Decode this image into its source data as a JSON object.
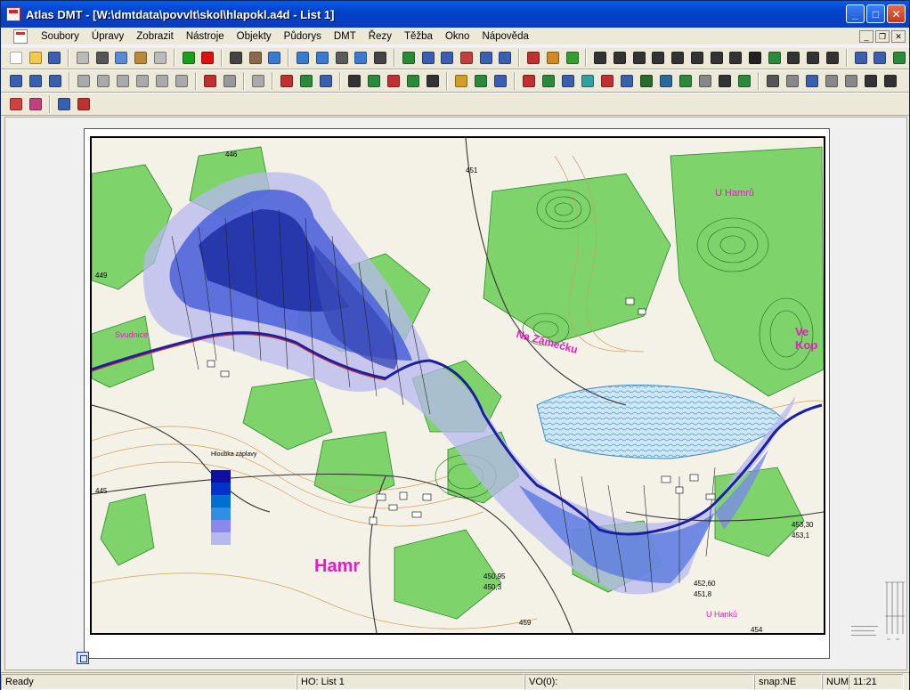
{
  "window": {
    "title": "Atlas DMT - [W:\\dmtdata\\povvlt\\skol\\hlapokl.a4d - List 1]"
  },
  "menu": [
    "Soubory",
    "Úpravy",
    "Zobrazit",
    "Nástroje",
    "Objekty",
    "Půdorys",
    "DMT",
    "Řezy",
    "Těžba",
    "Okno",
    "Nápověda"
  ],
  "toolbars": {
    "row1": [
      {
        "name": "new-icon",
        "color": "#ffffff"
      },
      {
        "name": "open-icon",
        "color": "#f2c94c"
      },
      {
        "name": "save-icon",
        "color": "#3a5fb0"
      },
      {
        "name": "sep"
      },
      {
        "name": "undo-icon",
        "color": "#bbbbbb"
      },
      {
        "name": "cut-icon",
        "color": "#555555"
      },
      {
        "name": "copy-icon",
        "color": "#5a8ad6"
      },
      {
        "name": "paste-icon",
        "color": "#b88a3a"
      },
      {
        "name": "redo-icon",
        "color": "#bbbbbb"
      },
      {
        "name": "sep"
      },
      {
        "name": "green-dot-icon",
        "color": "#1aa01a"
      },
      {
        "name": "red-dot-icon",
        "color": "#e01010"
      },
      {
        "name": "sep"
      },
      {
        "name": "pointer-icon",
        "color": "#444444"
      },
      {
        "name": "hand-icon",
        "color": "#8a6a4a"
      },
      {
        "name": "zoom-all-icon",
        "color": "#3a7ad0"
      },
      {
        "name": "sep"
      },
      {
        "name": "zoom-in-icon",
        "color": "#3a7ad0"
      },
      {
        "name": "zoom-window-icon",
        "color": "#3a7ad0"
      },
      {
        "name": "zoom-prev-icon",
        "color": "#5a5a5a"
      },
      {
        "name": "zoom-out-icon",
        "color": "#3a7ad0"
      },
      {
        "name": "axis-icon",
        "color": "#444444"
      },
      {
        "name": "sep"
      },
      {
        "name": "layers-icon",
        "color": "#2a8a3a"
      },
      {
        "name": "table-icon",
        "color": "#3a5fb0"
      },
      {
        "name": "text-box-icon",
        "color": "#3a5fb0"
      },
      {
        "name": "tool-icon",
        "color": "#c04040"
      },
      {
        "name": "grid-icon",
        "color": "#3a5fb0"
      },
      {
        "name": "window-icon",
        "color": "#3a5fb0"
      },
      {
        "name": "sep"
      },
      {
        "name": "measure-icon",
        "color": "#c03030"
      },
      {
        "name": "book-icon",
        "color": "#d08a20"
      },
      {
        "name": "check-icon",
        "color": "#30a030"
      },
      {
        "name": "sep"
      },
      {
        "name": "point-icon",
        "color": "#333333"
      },
      {
        "name": "line-icon",
        "color": "#333333"
      },
      {
        "name": "polyline-icon",
        "color": "#333333"
      },
      {
        "name": "segment-icon",
        "color": "#333333"
      },
      {
        "name": "arc-icon",
        "color": "#333333"
      },
      {
        "name": "rect-icon",
        "color": "#333333"
      },
      {
        "name": "circle-icon",
        "color": "#333333"
      },
      {
        "name": "curve-icon",
        "color": "#333333"
      },
      {
        "name": "text-icon",
        "color": "#222222"
      },
      {
        "name": "symbol-icon",
        "color": "#2a8a3a"
      },
      {
        "name": "rotate-icon",
        "color": "#333333"
      },
      {
        "name": "dimension-icon",
        "color": "#333333"
      },
      {
        "name": "frame-icon",
        "color": "#333333"
      },
      {
        "name": "sep"
      },
      {
        "name": "copy-sheet-icon",
        "color": "#3a5fb0"
      },
      {
        "name": "settings-icon",
        "color": "#3a5fb0"
      },
      {
        "name": "layers2-icon",
        "color": "#2a8a3a"
      }
    ],
    "row2": [
      {
        "name": "pudo-icon",
        "color": "#3a5fb0"
      },
      {
        "name": "dmt-icon",
        "color": "#3a5fb0"
      },
      {
        "name": "dmt2-icon",
        "color": "#3a5fb0"
      },
      {
        "name": "sep"
      },
      {
        "name": "gray1-icon",
        "color": "#aaaaaa"
      },
      {
        "name": "gray2-icon",
        "color": "#aaaaaa"
      },
      {
        "name": "gray3-icon",
        "color": "#aaaaaa"
      },
      {
        "name": "gray4-icon",
        "color": "#aaaaaa"
      },
      {
        "name": "gray5-icon",
        "color": "#aaaaaa"
      },
      {
        "name": "gray6-icon",
        "color": "#aaaaaa"
      },
      {
        "name": "sep"
      },
      {
        "name": "contour-icon",
        "color": "#c03030"
      },
      {
        "name": "contour2-icon",
        "color": "#999999"
      },
      {
        "name": "sep"
      },
      {
        "name": "dmt3-icon",
        "color": "#aaaaaa"
      },
      {
        "name": "sep"
      },
      {
        "name": "profile-icon",
        "color": "#c03030"
      },
      {
        "name": "section-icon",
        "color": "#2a8a3a"
      },
      {
        "name": "section2-icon",
        "color": "#3a5fb0"
      },
      {
        "name": "sep"
      },
      {
        "name": "node-icon",
        "color": "#333333"
      },
      {
        "name": "node2-icon",
        "color": "#2a8a3a"
      },
      {
        "name": "node3-icon",
        "color": "#c03030"
      },
      {
        "name": "arrow-down-icon",
        "color": "#2a8a3a"
      },
      {
        "name": "arrows-icon",
        "color": "#333333"
      },
      {
        "name": "sep"
      },
      {
        "name": "fill-icon",
        "color": "#d0a020"
      },
      {
        "name": "fill2-icon",
        "color": "#2a8a3a"
      },
      {
        "name": "fill3-icon",
        "color": "#3a5fb0"
      },
      {
        "name": "sep"
      },
      {
        "name": "ok-icon",
        "color": "#c03030"
      },
      {
        "name": "bucket-icon",
        "color": "#2a8a3a"
      },
      {
        "name": "flag-icon",
        "color": "#3a5fb0"
      },
      {
        "name": "color-icon",
        "color": "#30a0a0"
      },
      {
        "name": "palette-icon",
        "color": "#c03030"
      },
      {
        "name": "pencil-icon",
        "color": "#3a5fb0"
      },
      {
        "name": "hatch-icon",
        "color": "#2a6a2a"
      },
      {
        "name": "image-icon",
        "color": "#2a6a9a"
      },
      {
        "name": "photo-icon",
        "color": "#2a8a3a"
      },
      {
        "name": "mail-icon",
        "color": "#888888"
      },
      {
        "name": "export-icon",
        "color": "#333333"
      },
      {
        "name": "download-icon",
        "color": "#2a8a3a"
      },
      {
        "name": "sep"
      },
      {
        "name": "measure2-icon",
        "color": "#555555"
      },
      {
        "name": "building-icon",
        "color": "#888888"
      },
      {
        "name": "terrain-icon",
        "color": "#3a5fb0"
      },
      {
        "name": "terrain2-icon",
        "color": "#888888"
      },
      {
        "name": "terrain3-icon",
        "color": "#888888"
      },
      {
        "name": "arrow-left-icon",
        "color": "#333333"
      },
      {
        "name": "arrow-right-icon",
        "color": "#333333"
      }
    ],
    "row3": [
      {
        "name": "color-bars-icon",
        "color": "#d04040"
      },
      {
        "name": "eraser-icon",
        "color": "#c04080"
      },
      {
        "name": "sep"
      },
      {
        "name": "swap-icon",
        "color": "#3a5fb0"
      },
      {
        "name": "flag2-icon",
        "color": "#c03030"
      }
    ]
  },
  "map": {
    "legend_title": "Hloubka záplavy",
    "legend_colors": [
      "#1010a0",
      "#0033cc",
      "#0070d0",
      "#2f8fe0",
      "#8888ee",
      "#b8b8f0"
    ],
    "place_labels": [
      {
        "text": "Hamr",
        "color": "#e020c0"
      },
      {
        "text": "Svudnice",
        "color": "#e020c0"
      },
      {
        "text": "Na Zámečku",
        "color": "#e020c0"
      },
      {
        "text": "U Hamrů",
        "color": "#e020c0"
      },
      {
        "text": "Ve Kop",
        "color": "#e020c0"
      },
      {
        "text": "U Hanků",
        "color": "#e020c0"
      }
    ],
    "spot_heights": [
      "451",
      "453,30",
      "453,1",
      "450,95",
      "450,3",
      "452,60",
      "451,8",
      "445",
      "446",
      "449",
      "454",
      "459"
    ]
  },
  "status": {
    "ready": "Ready",
    "sheet": "HO: List 1",
    "vo": "VO(0):",
    "snap": "snap:NE",
    "num": "NUM",
    "time": "11:21"
  }
}
